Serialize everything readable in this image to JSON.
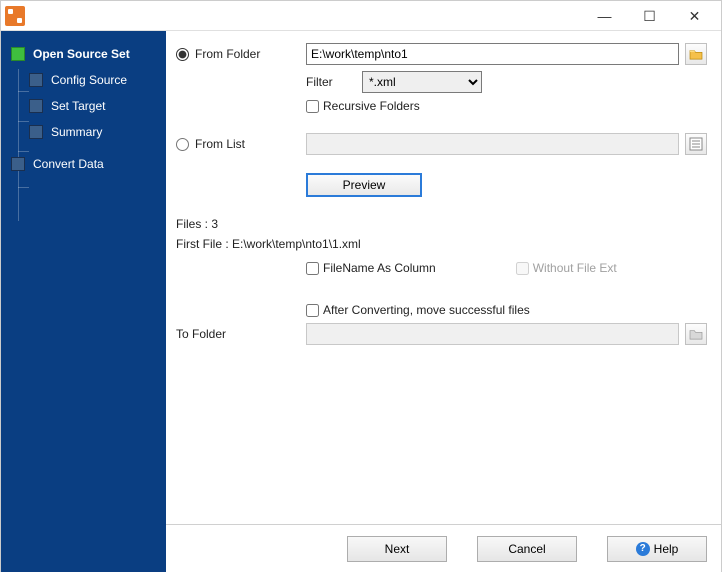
{
  "titlebar": {
    "title": ""
  },
  "sidebar": {
    "items": [
      {
        "label": "Open Source Set",
        "active": true
      },
      {
        "label": "Config Source"
      },
      {
        "label": "Set Target"
      },
      {
        "label": "Summary"
      },
      {
        "label": "Convert Data"
      }
    ]
  },
  "main": {
    "from_folder_label": "From Folder",
    "from_folder_value": "E:\\work\\temp\\nto1",
    "filter_label": "Filter",
    "filter_value": "*.xml",
    "recursive_label": "Recursive Folders",
    "from_list_label": "From List",
    "from_list_value": "",
    "preview_label": "Preview",
    "files_text": "Files : 3",
    "first_file_text": "First File : E:\\work\\temp\\nto1\\1.xml",
    "filename_col_label": "FileName As Column",
    "without_ext_label": "Without File Ext",
    "after_convert_label": "After Converting, move successful files",
    "to_folder_label": "To Folder",
    "to_folder_value": ""
  },
  "buttons": {
    "next": "Next",
    "cancel": "Cancel",
    "help": "Help"
  }
}
